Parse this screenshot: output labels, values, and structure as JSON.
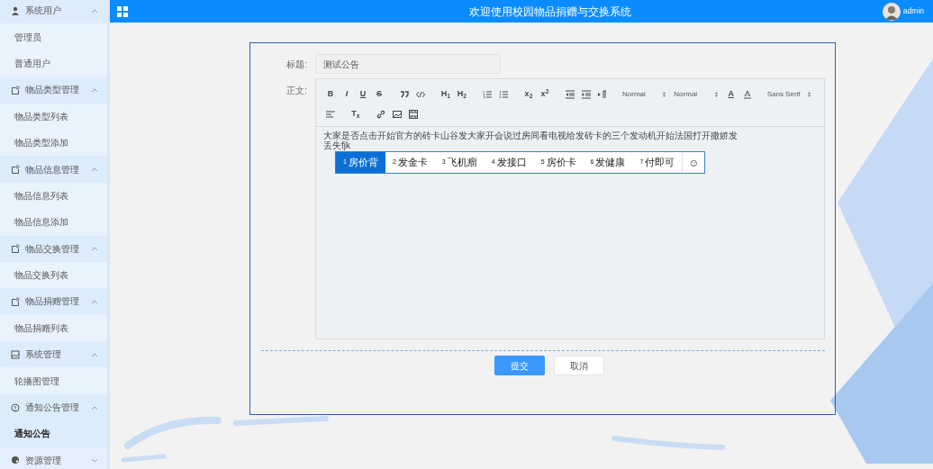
{
  "header": {
    "title": "欢迎使用校园物品捐赠与交换系统",
    "user": "admin"
  },
  "sidebar": {
    "groups": [
      {
        "label": "系统用户",
        "kind": "user",
        "expanded": true,
        "children": [
          {
            "label": "管理员",
            "selected": false
          },
          {
            "label": "普通用户",
            "selected": false
          }
        ]
      },
      {
        "label": "物品类型管理",
        "kind": "doc",
        "expanded": true,
        "children": [
          {
            "label": "物品类型列表",
            "selected": false
          },
          {
            "label": "物品类型添加",
            "selected": false
          }
        ]
      },
      {
        "label": "物品信息管理",
        "kind": "doc",
        "expanded": true,
        "children": [
          {
            "label": "物品信息列表",
            "selected": false
          },
          {
            "label": "物品信息添加",
            "selected": false
          }
        ]
      },
      {
        "label": "物品交换管理",
        "kind": "doc",
        "expanded": true,
        "children": [
          {
            "label": "物品交换列表",
            "selected": false
          }
        ]
      },
      {
        "label": "物品捐赠管理",
        "kind": "doc",
        "expanded": true,
        "children": [
          {
            "label": "物品捐赠列表",
            "selected": false
          }
        ]
      },
      {
        "label": "系统管理",
        "kind": "image",
        "expanded": true,
        "children": [
          {
            "label": "轮播图管理",
            "selected": false
          }
        ]
      },
      {
        "label": "通知公告管理",
        "kind": "info",
        "expanded": true,
        "children": [
          {
            "label": "通知公告",
            "selected": true
          }
        ]
      },
      {
        "label": "资源管理",
        "kind": "palette",
        "expanded": false
      }
    ]
  },
  "form": {
    "title_label": "标题:",
    "title_value": "测试公告",
    "body_label": "正文:",
    "toolbar": [
      [
        {
          "kind": "text",
          "label": "B"
        },
        {
          "kind": "text",
          "label": "I"
        },
        {
          "kind": "text",
          "label": "U"
        },
        {
          "kind": "text",
          "label": "S"
        },
        {
          "kind": "icon"
        },
        {
          "kind": "icon"
        },
        {
          "kind": "text",
          "label": "H$_{1}$"
        },
        {
          "kind": "text",
          "label": "H$_{2}$"
        },
        {
          "kind": "icon"
        },
        {
          "kind": "icon"
        },
        {
          "kind": "text",
          "label": "x$_{2}$"
        },
        {
          "kind": "text",
          "label": "x$^{2}$"
        },
        {
          "kind": "icon"
        },
        {
          "kind": "icon"
        },
        {
          "kind": "icon"
        },
        {
          "kind": "select",
          "label": "Normal"
        },
        {
          "kind": "select",
          "label": "Normal"
        },
        {
          "kind": "text",
          "label": "A"
        },
        {
          "kind": "icon"
        },
        {
          "kind": "select",
          "label": "Sans Serif"
        }
      ],
      [
        {
          "kind": "icon"
        },
        {
          "kind": "text",
          "label": "T$_{x}$"
        },
        {
          "kind": "icon"
        },
        {
          "kind": "icon"
        },
        {
          "kind": "icon"
        }
      ]
    ],
    "content": [
      "大家是否点击开始官方的砖卡山谷发大家开会说过房间看电视给发砖卡的三个发动机开始法国打开撒娇发",
      "丢失fjk"
    ],
    "candidates": [
      {
        "number": "1",
        "word": "房价背",
        "selected": true
      },
      {
        "number": "2",
        "word": "发金卡",
        "selected": false
      },
      {
        "number": "3",
        "word": "飞机瘤",
        "selected": false
      },
      {
        "number": "4",
        "word": "发接口",
        "selected": false
      },
      {
        "number": "5",
        "word": "房价卡",
        "selected": false
      },
      {
        "number": "6",
        "word": "发健康",
        "selected": false
      },
      {
        "number": "7",
        "word": "付即可",
        "selected": false
      }
    ],
    "candidate_emoji": "☺",
    "buttons": [
      {
        "label": "提交",
        "kind": "primary"
      },
      {
        "label": "取消",
        "kind": "default"
      }
    ]
  }
}
